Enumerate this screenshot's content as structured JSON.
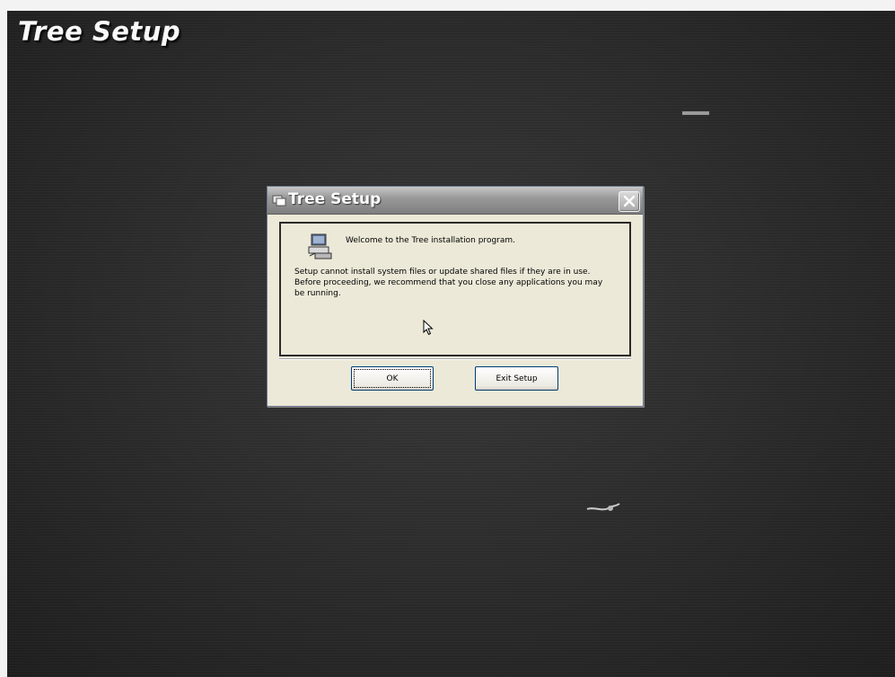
{
  "installer_title": "Tree Setup",
  "dialog": {
    "title": "Tree Setup",
    "welcome": "Welcome to the Tree installation program.",
    "message_lines": [
      "Setup cannot install system files or update shared files if they are in use.",
      "Before proceeding, we recommend that you close any applications you may",
      "be running."
    ],
    "buttons": {
      "ok": "OK",
      "exit": "Exit Setup"
    }
  },
  "colors": {
    "dialog_bg": "#ece9d8",
    "titlebar": "#8f8f8f",
    "backdrop": "#2b2b2b"
  },
  "icons": [
    "setup-computer-icon",
    "close-icon",
    "mouse-cursor-icon",
    "window-icon"
  ]
}
